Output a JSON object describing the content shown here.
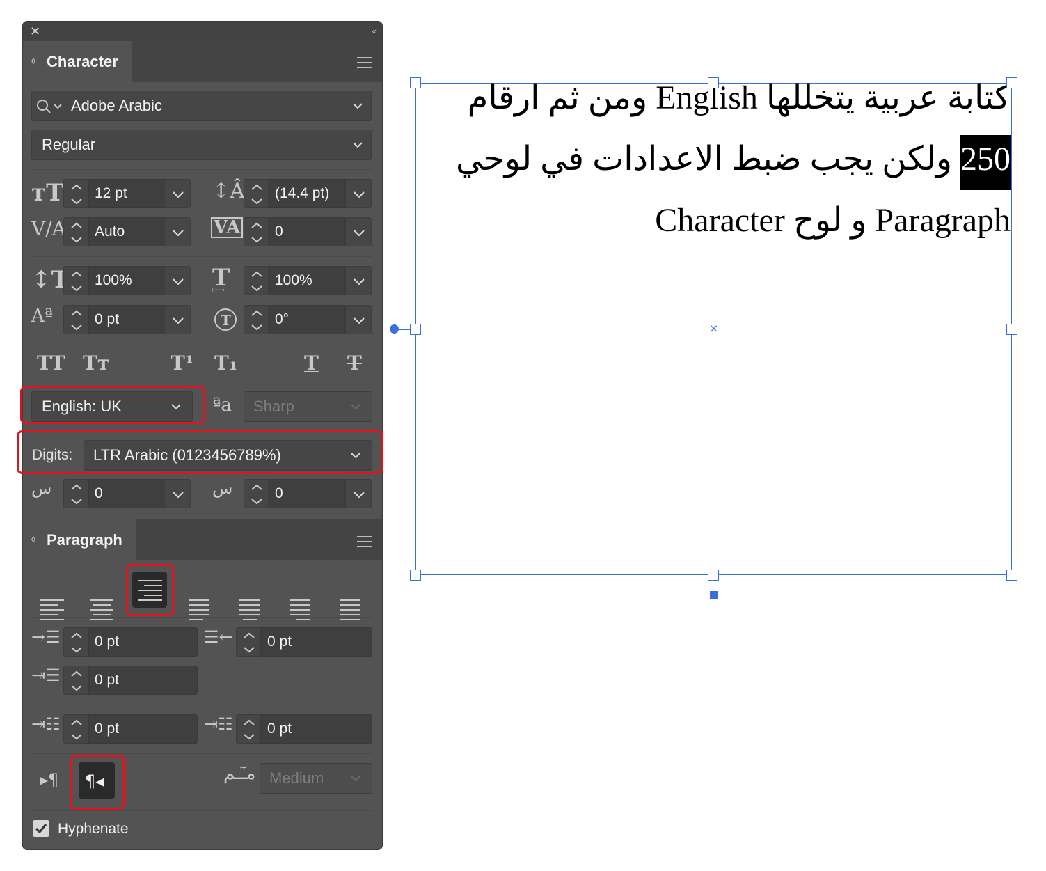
{
  "character_panel": {
    "tab_label": "Character",
    "font_family": "Adobe Arabic",
    "font_style": "Regular",
    "font_size": "12 pt",
    "leading": "(14.4 pt)",
    "kerning": "Auto",
    "tracking": "0",
    "vertical_scale": "100%",
    "horizontal_scale": "100%",
    "baseline_shift": "0 pt",
    "rotation": "0°",
    "style_buttons": [
      "TT",
      "Tт",
      "T¹",
      "T₁",
      "T",
      "T"
    ],
    "language": "English: UK",
    "antialias_icon_text": "ªa",
    "antialias": "Sharp",
    "digits_label": "Digits:",
    "digits_value": "LTR Arabic (0123456789%)",
    "diacritic_x": "0",
    "diacritic_y": "0"
  },
  "paragraph_panel": {
    "tab_label": "Paragraph",
    "left_indent": "0 pt",
    "right_indent": "0 pt",
    "first_line_indent": "0 pt",
    "space_before": "0 pt",
    "space_after": "0 pt",
    "direction_ltr_icon": "▸¶",
    "direction_rtl_icon": "¶◂",
    "kashida_icon_text": "مـٓـم",
    "kashida": "Medium",
    "hyphenate_label": "Hyphenate",
    "hyphenate_checked": true
  },
  "text_frame": {
    "line1": "كتابة عربية يتخللها English ومن ثم ارقام",
    "line2_highlight": "250",
    "line2_rest": "ولكن يجب ضبط الاعدادات في لوحي",
    "line3": "Paragraph و لوح Character"
  },
  "colors": {
    "panel_bg": "#535353",
    "highlight_red": "#e0141e",
    "selection_blue": "#3a6fe0"
  }
}
